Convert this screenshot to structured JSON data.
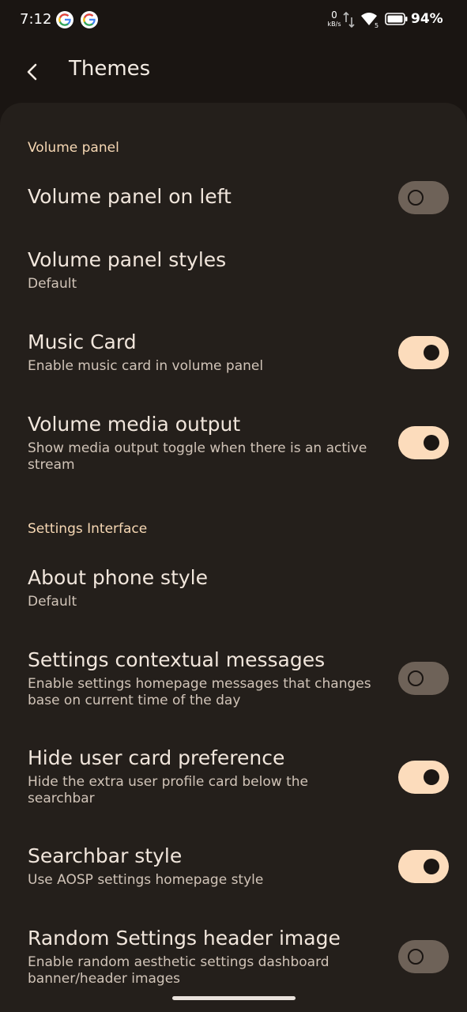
{
  "status_bar": {
    "time": "7:12",
    "net_speed_value": "0",
    "net_speed_unit": "kB/s",
    "battery_percent": "94%"
  },
  "header": {
    "title": "Themes"
  },
  "sections": {
    "volume_panel": {
      "label": "Volume panel"
    },
    "settings_interface": {
      "label": "Settings Interface"
    }
  },
  "items": {
    "volume_panel_on_left": {
      "title": "Volume panel on left",
      "enabled": false
    },
    "volume_panel_styles": {
      "title": "Volume panel styles",
      "summary": "Default"
    },
    "music_card": {
      "title": "Music Card",
      "summary": "Enable music card in volume panel",
      "enabled": true
    },
    "volume_media_output": {
      "title": "Volume media output",
      "summary": "Show media output toggle when there is an active stream",
      "enabled": true
    },
    "about_phone_style": {
      "title": "About phone style",
      "summary": "Default"
    },
    "settings_contextual_messages": {
      "title": "Settings contextual messages",
      "summary": "Enable settings homepage messages that changes base on current time of the day",
      "enabled": false
    },
    "hide_user_card": {
      "title": "Hide user card preference",
      "summary": "Hide the extra user profile card below the searchbar",
      "enabled": true
    },
    "searchbar_style": {
      "title": "Searchbar style",
      "summary": "Use AOSP settings homepage style",
      "enabled": true
    },
    "random_header_image": {
      "title": "Random Settings header image",
      "summary": "Enable random aesthetic settings dashboard banner/header images",
      "enabled": false
    }
  },
  "colors": {
    "background": "#1a1512",
    "panel": "#241f1b",
    "accent": "#fcdcbc",
    "section_header": "#f7d8b4",
    "toggle_off": "#6e6258"
  }
}
